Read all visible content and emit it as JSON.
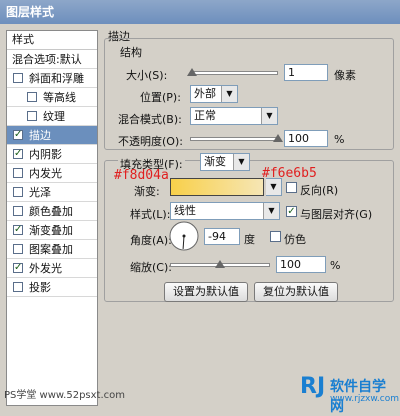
{
  "window": {
    "title": "图层样式"
  },
  "left_panel": {
    "header": "样式",
    "items": [
      {
        "label": "混合选项:默认",
        "checked": null,
        "selected": false,
        "indent": false
      },
      {
        "label": "斜面和浮雕",
        "checked": false,
        "selected": false,
        "indent": false
      },
      {
        "label": "等高线",
        "checked": false,
        "selected": false,
        "indent": true
      },
      {
        "label": "纹理",
        "checked": false,
        "selected": false,
        "indent": true
      },
      {
        "label": "描边",
        "checked": true,
        "selected": true,
        "indent": false
      },
      {
        "label": "内阴影",
        "checked": true,
        "selected": false,
        "indent": false
      },
      {
        "label": "内发光",
        "checked": false,
        "selected": false,
        "indent": false
      },
      {
        "label": "光泽",
        "checked": false,
        "selected": false,
        "indent": false
      },
      {
        "label": "颜色叠加",
        "checked": false,
        "selected": false,
        "indent": false
      },
      {
        "label": "渐变叠加",
        "checked": true,
        "selected": false,
        "indent": false
      },
      {
        "label": "图案叠加",
        "checked": false,
        "selected": false,
        "indent": false
      },
      {
        "label": "外发光",
        "checked": true,
        "selected": false,
        "indent": false
      },
      {
        "label": "投影",
        "checked": false,
        "selected": false,
        "indent": false
      }
    ]
  },
  "stroke": {
    "section_title": "描边",
    "structure_title": "结构",
    "size_label": "大小(S):",
    "size_value": "1",
    "size_unit": "像素",
    "size_level": 0.02,
    "position_label": "位置(P):",
    "position_value": "外部",
    "blend_label": "混合模式(B):",
    "blend_value": "正常",
    "opacity_label": "不透明度(O):",
    "opacity_value": "100",
    "opacity_unit": "%",
    "opacity_level": 1.0
  },
  "fill": {
    "fill_type_label": "填充类型(F):",
    "fill_type_value": "渐变",
    "gradient_label": "渐变:",
    "gradient_color_start": "#f8d04a",
    "gradient_color_end": "#f6e6b5",
    "reverse_label": "反向(R)",
    "reverse_checked": false,
    "style_label": "样式(L):",
    "style_value": "线性",
    "align_label": "与图层对齐(G)",
    "align_checked": true,
    "angle_label": "角度(A):",
    "angle_value": "-94",
    "angle_unit": "度",
    "dither_label": "仿色",
    "dither_checked": false,
    "scale_label": "缩放(C):",
    "scale_value": "100",
    "scale_unit": "%",
    "scale_level": 0.5
  },
  "buttons": {
    "make_default": "设置为默认值",
    "reset_default": "复位为默认值"
  },
  "annotations": {
    "start_color": "#f8d04a",
    "end_color": "#f6e6b5"
  },
  "watermarks": {
    "left": "PS学堂 www.52psxt.com",
    "right_logo": "RJ",
    "right_text": "软件自学网",
    "right_url": "www.rjzxw.com"
  }
}
